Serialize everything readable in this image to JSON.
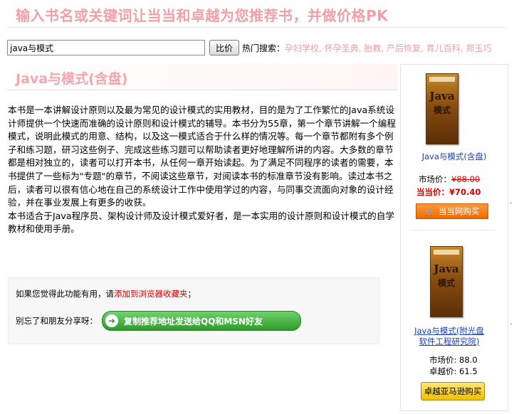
{
  "banner": "输入书名或关键词让当当和卓越为您推荐书，并做价格PK",
  "search": {
    "value": "java与模式",
    "button": "比价",
    "hot_label": "热门搜索：",
    "hot_items": [
      "孕妇学校",
      "怀孕圣典",
      "胎教",
      "产后恢复",
      "育儿百科",
      "郑玉巧"
    ]
  },
  "book": {
    "title": "Java与模式(含盘)",
    "description": [
      "本书是一本讲解设计原则以及最为常见的设计模式的实用教材，目的是为了工作繁忙的Java系统设计师提供一个快速而准确的设计原则和设计模式的辅导。本书分为55章，第一个章节讲解一个编程模式，说明此模式的用意、结构，以及这一模式适合于什么样的情况等。每一个章节都附有多个例子和练习题，研习这些例子、完成这些练习题可以帮助读者更好地理解所讲的内容。大多数的章节都是相对独立的，读者可以打开本书，从任何一章开始读起。为了满足不同程序的读者的需要，本书提供了一些标为\"专题\"的章节，不阅读这些章节，对阅读本书的标准章节没有影响。读过本书之后，读者可以很有信心地在自己的系统设计工作中使用学过的内容，与同事交流面向对象的设计经验，并在事业发展上有更多的收获。",
      "本书适合于Java程序员、架构设计师及设计模式爱好者，是一本实用的设计原则和设计模式的自学教材和使用手册。"
    ]
  },
  "share": {
    "prefix": "如果您觉得此功能有用，请",
    "bookmark_link": "添加到浏览器收藏夹",
    "suffix": "；",
    "friends_label": "别忘了和朋友分享呀：",
    "copy_button": "复制推荐地址发送给QQ和MSN好友"
  },
  "sidebar": {
    "dangdang": {
      "cover_java": "Java",
      "cover_cn": "模式",
      "link": "Java与模式(含盘)",
      "market_label": "市场价：",
      "market_price": "¥88.00",
      "dd_label": "当当价：",
      "dd_price": "¥70.40",
      "buy_button": "当当网购买"
    },
    "joyo": {
      "cover_java": "Java",
      "cover_cn": "模式",
      "link": "Java与模式(附光盘软件工程研究院)",
      "market_line": "市场价: 88.0",
      "joyo_line": "卓越价: 61.5",
      "buy_button": "卓越亚马逊购买"
    }
  },
  "colors": {
    "banner": "#f0a0a8",
    "link_blue": "#1a3fb0",
    "price_red": "#d40000",
    "dd_button": "#ee6a00",
    "joyo_button": "#f0c000",
    "share_green": "#2f9a2c"
  }
}
